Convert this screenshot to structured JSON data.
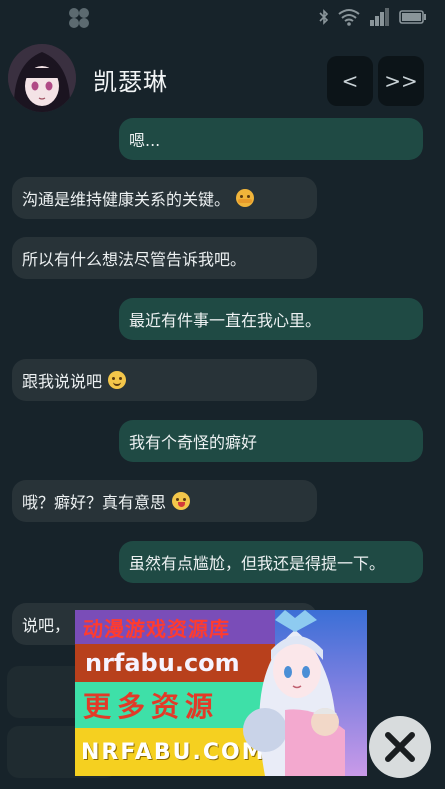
{
  "header": {
    "character_name": "凯瑟琳",
    "prev_label": "<",
    "next_label": ">>"
  },
  "messages": [
    {
      "side": "out",
      "text": "嗯..."
    },
    {
      "side": "in",
      "text": "沟通是维持健康关系的关键。",
      "emoji": "hugging-face-emoji"
    },
    {
      "side": "in",
      "text": "所以有什么想法尽管告诉我吧。"
    },
    {
      "side": "out",
      "text": "最近有件事一直在我心里。"
    },
    {
      "side": "in",
      "text": "跟我说说吧",
      "emoji": "slightly-smiling-emoji"
    },
    {
      "side": "out",
      "text": "我有个奇怪的癖好"
    },
    {
      "side": "in",
      "text": "哦？癖好？真有意思",
      "emoji": "winking-tongue-emoji"
    },
    {
      "side": "out",
      "text": "虽然有点尴尬，但我还是得提一下。"
    },
    {
      "side": "in",
      "text": "说吧，"
    }
  ],
  "ad": {
    "line1": "动漫游戏资源库",
    "line2": "nrfabu.com",
    "line3": "更多资源",
    "line4": "NRFABU.COM"
  },
  "colors": {
    "background": "#17232a",
    "incoming_bubble": "#283338",
    "outgoing_bubble": "#1f4a44"
  }
}
